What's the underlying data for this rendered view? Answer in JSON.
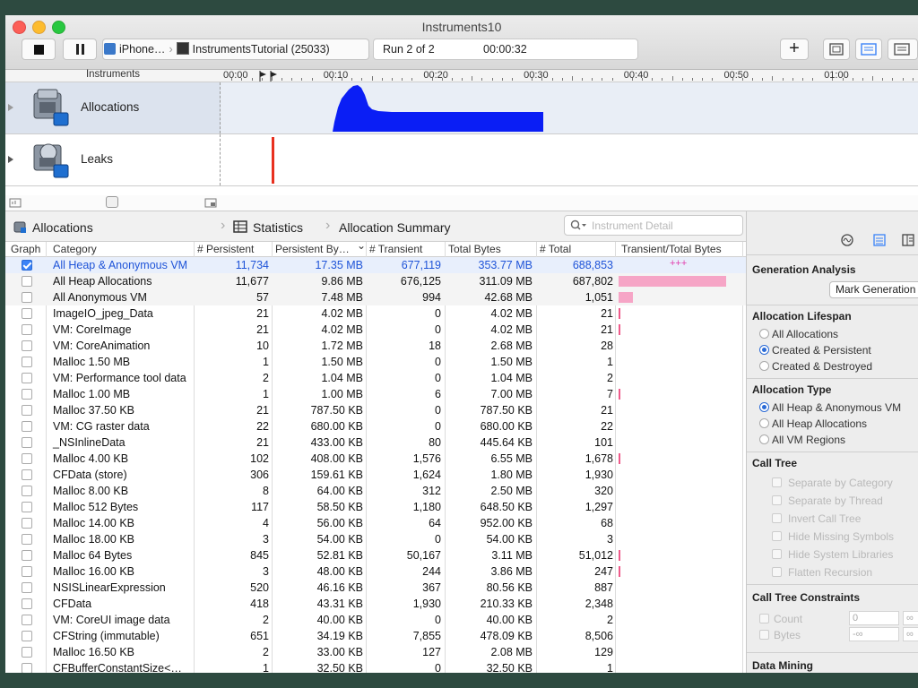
{
  "window": {
    "title": "Instruments10"
  },
  "toolbar": {
    "target_device": "iPhone…",
    "target_process": "InstrumentsTutorial (25033)",
    "run_label": "Run 2 of 2",
    "elapsed": "00:00:32",
    "add_label": "+"
  },
  "ruler": {
    "instruments_label": "Instruments",
    "ticks": [
      "00:00",
      "00:10",
      "00:20",
      "00:30",
      "00:40",
      "00:50",
      "01:00"
    ]
  },
  "tracks": [
    {
      "name": "Allocations"
    },
    {
      "name": "Leaks"
    }
  ],
  "nav": {
    "root": "Allocations",
    "view": "Statistics",
    "detail": "Allocation Summary",
    "search_placeholder": "Instrument Detail"
  },
  "table": {
    "columns": [
      "Graph",
      "Category",
      "# Persistent",
      "Persistent By…",
      "# Transient",
      "Total Bytes",
      "# Total",
      "Transient/Total Bytes"
    ],
    "rows": [
      {
        "checked": true,
        "category": "All Heap & Anonymous VM",
        "persistent": "11,734",
        "persistent_bytes": "17.35 MB",
        "transient": "677,119",
        "total_bytes": "353.77 MB",
        "total": "688,853",
        "bar_text": "+++",
        "bar": 0
      },
      {
        "checked": false,
        "category": "All Heap Allocations",
        "persistent": "11,677",
        "persistent_bytes": "9.86 MB",
        "transient": "676,125",
        "total_bytes": "311.09 MB",
        "total": "687,802",
        "bar_text": "",
        "bar": 0.97
      },
      {
        "checked": false,
        "category": "All Anonymous VM",
        "persistent": "57",
        "persistent_bytes": "7.48 MB",
        "transient": "994",
        "total_bytes": "42.68 MB",
        "total": "1,051",
        "bar_text": "",
        "bar": 0.13
      },
      {
        "checked": false,
        "category": "ImageIO_jpeg_Data",
        "persistent": "21",
        "persistent_bytes": "4.02 MB",
        "transient": "0",
        "total_bytes": "4.02 MB",
        "total": "21",
        "bar_text": "",
        "bar": 0.01
      },
      {
        "checked": false,
        "category": "VM: CoreImage",
        "persistent": "21",
        "persistent_bytes": "4.02 MB",
        "transient": "0",
        "total_bytes": "4.02 MB",
        "total": "21",
        "bar_text": "",
        "bar": 0.01
      },
      {
        "checked": false,
        "category": "VM: CoreAnimation",
        "persistent": "10",
        "persistent_bytes": "1.72 MB",
        "transient": "18",
        "total_bytes": "2.68 MB",
        "total": "28",
        "bar_text": "",
        "bar": 0
      },
      {
        "checked": false,
        "category": "Malloc 1.50 MB",
        "persistent": "1",
        "persistent_bytes": "1.50 MB",
        "transient": "0",
        "total_bytes": "1.50 MB",
        "total": "1",
        "bar_text": "",
        "bar": 0
      },
      {
        "checked": false,
        "category": "VM: Performance tool data",
        "persistent": "2",
        "persistent_bytes": "1.04 MB",
        "transient": "0",
        "total_bytes": "1.04 MB",
        "total": "2",
        "bar_text": "",
        "bar": 0
      },
      {
        "checked": false,
        "category": "Malloc 1.00 MB",
        "persistent": "1",
        "persistent_bytes": "1.00 MB",
        "transient": "6",
        "total_bytes": "7.00 MB",
        "total": "7",
        "bar_text": "",
        "bar": 0.01
      },
      {
        "checked": false,
        "category": "Malloc 37.50 KB",
        "persistent": "21",
        "persistent_bytes": "787.50 KB",
        "transient": "0",
        "total_bytes": "787.50 KB",
        "total": "21",
        "bar_text": "",
        "bar": 0
      },
      {
        "checked": false,
        "category": "VM: CG raster data",
        "persistent": "22",
        "persistent_bytes": "680.00 KB",
        "transient": "0",
        "total_bytes": "680.00 KB",
        "total": "22",
        "bar_text": "",
        "bar": 0
      },
      {
        "checked": false,
        "category": "_NSInlineData",
        "persistent": "21",
        "persistent_bytes": "433.00 KB",
        "transient": "80",
        "total_bytes": "445.64 KB",
        "total": "101",
        "bar_text": "",
        "bar": 0
      },
      {
        "checked": false,
        "category": "Malloc 4.00 KB",
        "persistent": "102",
        "persistent_bytes": "408.00 KB",
        "transient": "1,576",
        "total_bytes": "6.55 MB",
        "total": "1,678",
        "bar_text": "",
        "bar": 0.01
      },
      {
        "checked": false,
        "category": "CFData (store)",
        "persistent": "306",
        "persistent_bytes": "159.61 KB",
        "transient": "1,624",
        "total_bytes": "1.80 MB",
        "total": "1,930",
        "bar_text": "",
        "bar": 0
      },
      {
        "checked": false,
        "category": "Malloc 8.00 KB",
        "persistent": "8",
        "persistent_bytes": "64.00 KB",
        "transient": "312",
        "total_bytes": "2.50 MB",
        "total": "320",
        "bar_text": "",
        "bar": 0
      },
      {
        "checked": false,
        "category": "Malloc 512 Bytes",
        "persistent": "117",
        "persistent_bytes": "58.50 KB",
        "transient": "1,180",
        "total_bytes": "648.50 KB",
        "total": "1,297",
        "bar_text": "",
        "bar": 0
      },
      {
        "checked": false,
        "category": "Malloc 14.00 KB",
        "persistent": "4",
        "persistent_bytes": "56.00 KB",
        "transient": "64",
        "total_bytes": "952.00 KB",
        "total": "68",
        "bar_text": "",
        "bar": 0
      },
      {
        "checked": false,
        "category": "Malloc 18.00 KB",
        "persistent": "3",
        "persistent_bytes": "54.00 KB",
        "transient": "0",
        "total_bytes": "54.00 KB",
        "total": "3",
        "bar_text": "",
        "bar": 0
      },
      {
        "checked": false,
        "category": "Malloc 64 Bytes",
        "persistent": "845",
        "persistent_bytes": "52.81 KB",
        "transient": "50,167",
        "total_bytes": "3.11 MB",
        "total": "51,012",
        "bar_text": "",
        "bar": 0.005
      },
      {
        "checked": false,
        "category": "Malloc 16.00 KB",
        "persistent": "3",
        "persistent_bytes": "48.00 KB",
        "transient": "244",
        "total_bytes": "3.86 MB",
        "total": "247",
        "bar_text": "",
        "bar": 0.005
      },
      {
        "checked": false,
        "category": "NSISLinearExpression",
        "persistent": "520",
        "persistent_bytes": "46.16 KB",
        "transient": "367",
        "total_bytes": "80.56 KB",
        "total": "887",
        "bar_text": "",
        "bar": 0
      },
      {
        "checked": false,
        "category": "CFData",
        "persistent": "418",
        "persistent_bytes": "43.31 KB",
        "transient": "1,930",
        "total_bytes": "210.33 KB",
        "total": "2,348",
        "bar_text": "",
        "bar": 0
      },
      {
        "checked": false,
        "category": "VM: CoreUI image data",
        "persistent": "2",
        "persistent_bytes": "40.00 KB",
        "transient": "0",
        "total_bytes": "40.00 KB",
        "total": "2",
        "bar_text": "",
        "bar": 0
      },
      {
        "checked": false,
        "category": "CFString (immutable)",
        "persistent": "651",
        "persistent_bytes": "34.19 KB",
        "transient": "7,855",
        "total_bytes": "478.09 KB",
        "total": "8,506",
        "bar_text": "",
        "bar": 0
      },
      {
        "checked": false,
        "category": "Malloc 16.50 KB",
        "persistent": "2",
        "persistent_bytes": "33.00 KB",
        "transient": "127",
        "total_bytes": "2.08 MB",
        "total": "129",
        "bar_text": "",
        "bar": 0
      },
      {
        "checked": false,
        "category": "CFBufferConstantSize<…",
        "persistent": "1",
        "persistent_bytes": "32.50 KB",
        "transient": "0",
        "total_bytes": "32.50 KB",
        "total": "1",
        "bar_text": "",
        "bar": 0
      }
    ]
  },
  "panel": {
    "generation_analysis": "Generation Analysis",
    "mark_generation": "Mark Generation",
    "lifespan_title": "Allocation Lifespan",
    "lifespan_options": [
      "All Allocations",
      "Created & Persistent",
      "Created & Destroyed"
    ],
    "lifespan_selected": 1,
    "type_title": "Allocation Type",
    "type_options": [
      "All Heap & Anonymous VM",
      "All Heap Allocations",
      "All VM Regions"
    ],
    "type_selected": 0,
    "call_tree_title": "Call Tree",
    "call_tree_options": [
      "Separate by Category",
      "Separate by Thread",
      "Invert Call Tree",
      "Hide Missing Symbols",
      "Hide System Libraries",
      "Flatten Recursion"
    ],
    "constraints_title": "Call Tree Constraints",
    "constraint_count": "Count",
    "constraint_bytes": "Bytes",
    "count_min": "0",
    "bytes_min": "-∞",
    "max_value": "∞",
    "data_mining_title": "Data Mining"
  },
  "colors": {
    "alloc_graph": "#0a1ef5",
    "leak_marker": "#e8311f",
    "bar": "#f6a5c6",
    "accent": "#3b83f7"
  }
}
